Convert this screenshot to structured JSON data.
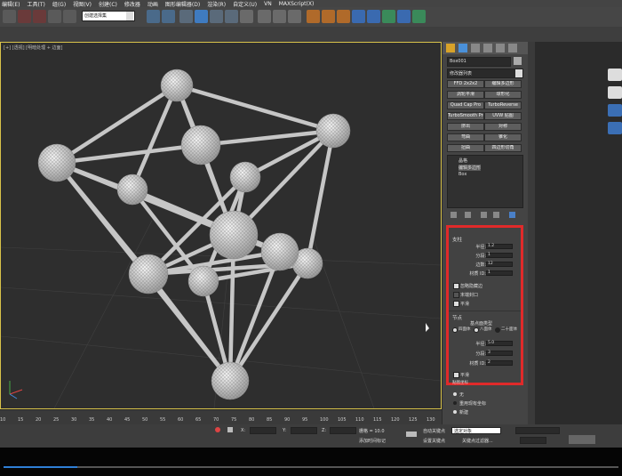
{
  "menu": [
    "编辑(E)",
    "工具(T)",
    "组(G)",
    "视图(V)",
    "创建(C)",
    "修改器",
    "动画",
    "图形编辑器(D)",
    "渲染(R)",
    "自定义(U)",
    "VN",
    "MAXScript(X)"
  ],
  "toolbar": {
    "selection_set": "创建选择集"
  },
  "viewport": {
    "label": "[+] [透视] [明暗处理 + 边面]"
  },
  "command_panel": {
    "object_name": "Box001",
    "modifier_list": "修改器列表",
    "buttons": [
      "FFD 2x2x2",
      "编辑多边形",
      "涡轮平滑",
      "球形化",
      "Quad Cap Pro",
      "TurboReverse",
      "TurboSmooth Pro",
      "UVW 贴图",
      "挤出",
      "对称",
      "弯曲",
      "锥化",
      "扭曲",
      "四边形切角"
    ],
    "stack": [
      "晶格",
      "编辑多边形",
      "Box"
    ]
  },
  "params": {
    "struts_title": "支柱",
    "radius_label": "半径:",
    "radius_value": "1.2",
    "segments_label": "分段:",
    "segments_value": "1",
    "sides_label": "边数:",
    "sides_value": "12",
    "material_label": "材质 ID:",
    "material_value": "1",
    "ignore_hidden": "忽略隐藏边",
    "end_caps": "末端封口",
    "smooth": "平滑",
    "joints_title": "节点",
    "geodesic_title": "基点面类型",
    "tetra": "四面体",
    "octa": "八面体",
    "icosa": "二十面体",
    "j_radius_label": "半径:",
    "j_radius_value": "5.0",
    "j_segments_label": "分段:",
    "j_segments_value": "3",
    "j_material_label": "材质 ID:",
    "j_material_value": "2",
    "j_smooth": "平滑",
    "mapping_title": "贴图坐标"
  },
  "mapping_options": [
    "无",
    "重用现有坐标",
    "新建"
  ],
  "timeline": {
    "ticks": [
      "10",
      "15",
      "20",
      "25",
      "30",
      "35",
      "40",
      "45",
      "50",
      "55",
      "60",
      "65",
      "70",
      "75",
      "80",
      "85",
      "90",
      "95",
      "100",
      "105",
      "110",
      "115",
      "120",
      "125",
      "130"
    ]
  },
  "status": {
    "x_label": "X:",
    "y_label": "Y:",
    "z_label": "Z:",
    "grid": "栅格 = 10.0",
    "add_time_tag": "添加时间标记",
    "auto_key": "自动关键点",
    "set_key": "设置关键点",
    "selected_object": "选定对象",
    "key_filters": "关键点过滤器..."
  },
  "video": {
    "progress": 0.12
  },
  "colors": {
    "viewport_border": "#d8c24a",
    "highlight": "#e02a2a",
    "progress": "#2f7fd6"
  }
}
